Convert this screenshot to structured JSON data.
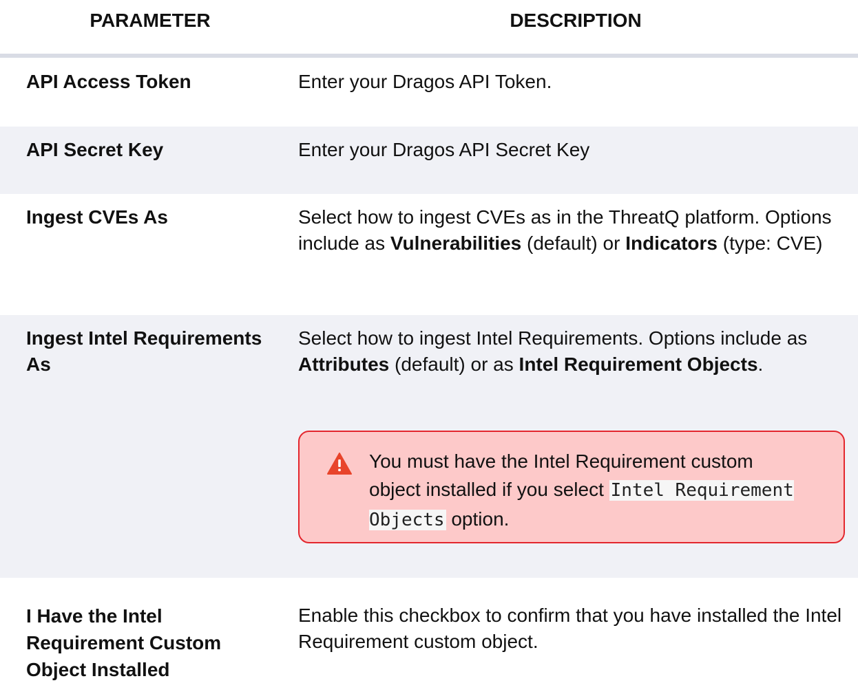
{
  "header": {
    "parameter": "PARAMETER",
    "description": "DESCRIPTION"
  },
  "rows": [
    {
      "parameter": "API Access Token",
      "description": "Enter your Dragos API Token."
    },
    {
      "parameter": "API Secret Key",
      "description": "Enter your Dragos API Secret Key"
    },
    {
      "parameter": "Ingest CVEs As",
      "description": {
        "intro": "Select how to ingest CVEs as in the ThreatQ platform. Options include as ",
        "option1": "Vulnerabilities",
        "mid": " (default) or ",
        "option2": "Indicators",
        "end": " (type: CVE)"
      }
    },
    {
      "parameter": "Ingest Intel Requirements As",
      "description": {
        "intro": "Select how to ingest Intel Requirements. Options include as ",
        "option1": "Attributes",
        "mid": " (default) or as ",
        "option2": "Intel Requirement Objects",
        "end": "."
      },
      "warning": {
        "icon": "warning-triangle-icon",
        "text_before": "You must have the Intel Requirement custom object installed if you select ",
        "code": "Intel Requirement Objects",
        "text_after": " option."
      }
    },
    {
      "parameter": "I Have the Intel Requirement Custom Object Installed",
      "description": "Enable this checkbox to confirm that you have installed the Intel Requirement custom object."
    }
  ],
  "colors": {
    "header_border": "#d9dce5",
    "alt_row": "#f0f1f6",
    "warning_bg": "#fdc9c9",
    "warning_border": "#e3262d",
    "warning_icon": "#e8442b"
  }
}
